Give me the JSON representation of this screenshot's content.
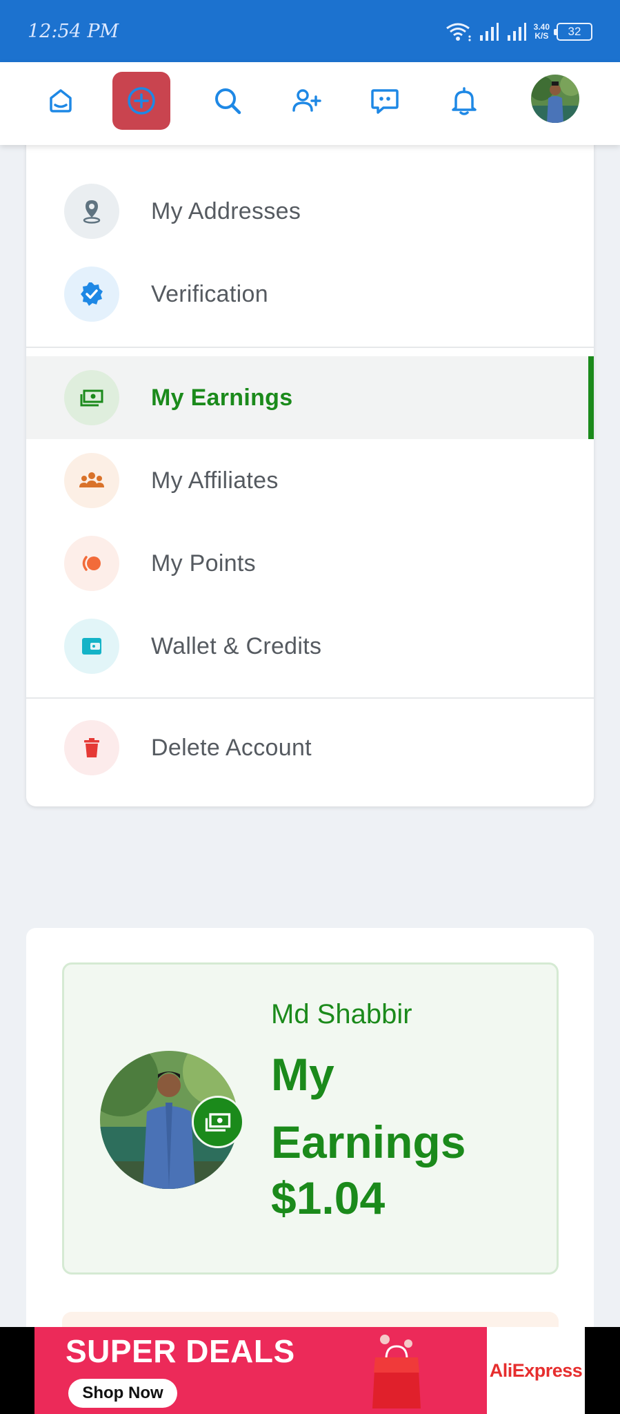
{
  "status_bar": {
    "time": "12:54 PM",
    "speed_value": "3.40",
    "speed_unit": "K/S",
    "battery": "32"
  },
  "top_nav": {
    "items": [
      {
        "icon": "inbox-icon"
      },
      {
        "icon": "plus-circle-icon"
      },
      {
        "icon": "search-icon"
      },
      {
        "icon": "add-user-icon"
      },
      {
        "icon": "chat-icon"
      },
      {
        "icon": "bell-icon"
      },
      {
        "icon": "avatar"
      }
    ]
  },
  "menu": {
    "items": [
      {
        "label": "My Addresses",
        "icon": "location-pin-icon"
      },
      {
        "label": "Verification",
        "icon": "verified-badge-icon"
      },
      {
        "label": "My Earnings",
        "icon": "money-icon",
        "active": true
      },
      {
        "label": "My Affiliates",
        "icon": "group-icon"
      },
      {
        "label": "My Points",
        "icon": "points-icon"
      },
      {
        "label": "Wallet & Credits",
        "icon": "wallet-icon"
      },
      {
        "label": "Delete Account",
        "icon": "trash-icon"
      }
    ]
  },
  "earnings": {
    "name": "Md Shabbir",
    "title": "My Earnings",
    "amount": "$1.04"
  },
  "ad": {
    "title": "SUPER DEALS",
    "button": "Shop Now",
    "brand": "AliExpress"
  },
  "colors": {
    "status_bar": "#1c72cf",
    "nav_icon": "#1e88e5",
    "create_button": "#c9444f",
    "earnings_green": "#1b8a1b",
    "ad_pink": "#ec2a59"
  }
}
